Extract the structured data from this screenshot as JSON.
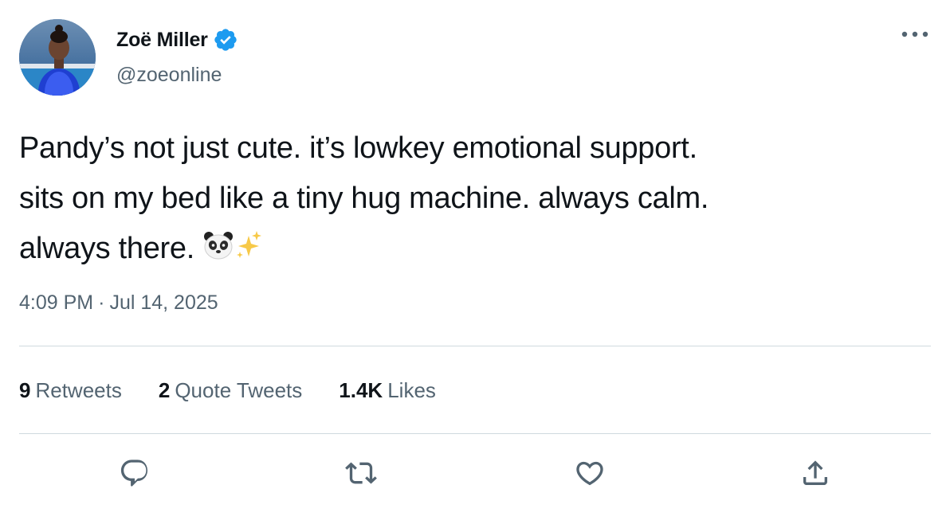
{
  "user": {
    "display_name": "Zoë Miller",
    "handle": "@zoeonline",
    "verified": true,
    "verified_color": "#1d9bf0",
    "avatar_icon": "profile-photo"
  },
  "tweet": {
    "lines": [
      "Pandy’s not just cute. it’s lowkey emotional support.",
      "sits on my bed like a tiny hug machine. always calm.",
      "always there."
    ],
    "emojis": [
      "panda-face-emoji",
      "sparkles-emoji"
    ],
    "time": "4:09 PM",
    "separator": "·",
    "date": "Jul 14, 2025"
  },
  "stats": {
    "retweets": {
      "count": "9",
      "label": "Retweets"
    },
    "quotes": {
      "count": "2",
      "label": "Quote Tweets"
    },
    "likes": {
      "count": "1.4K",
      "label": "Likes"
    }
  },
  "actions": [
    "reply-icon",
    "retweet-icon",
    "like-icon",
    "share-icon"
  ],
  "colors": {
    "text": "#0f1419",
    "secondary": "#536471",
    "divider": "#cfd9de",
    "accent": "#1d9bf0"
  }
}
